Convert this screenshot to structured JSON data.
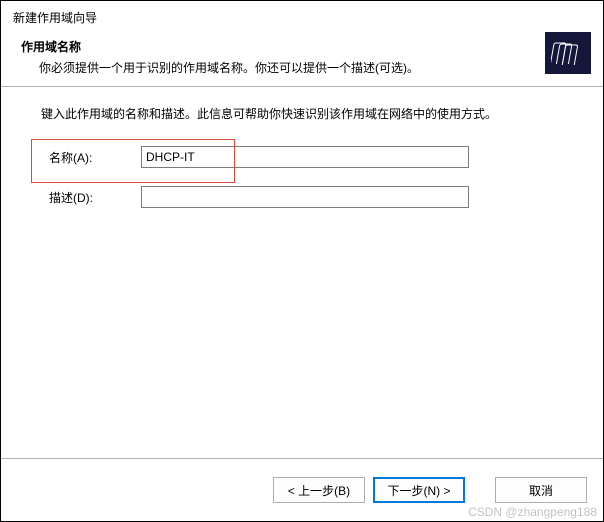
{
  "window": {
    "title": "新建作用域向导"
  },
  "header": {
    "heading": "作用域名称",
    "subtext": "你必须提供一个用于识别的作用域名称。你还可以提供一个描述(可选)。"
  },
  "body": {
    "instruction": "键入此作用域的名称和描述。此信息可帮助你快速识别该作用域在网络中的使用方式。"
  },
  "fields": {
    "name": {
      "label": "名称(A):",
      "value": "DHCP-IT"
    },
    "description": {
      "label": "描述(D):",
      "value": ""
    }
  },
  "buttons": {
    "back": "< 上一步(B)",
    "next": "下一步(N) >",
    "cancel": "取消"
  },
  "watermark": "CSDN @zhangpeng188"
}
